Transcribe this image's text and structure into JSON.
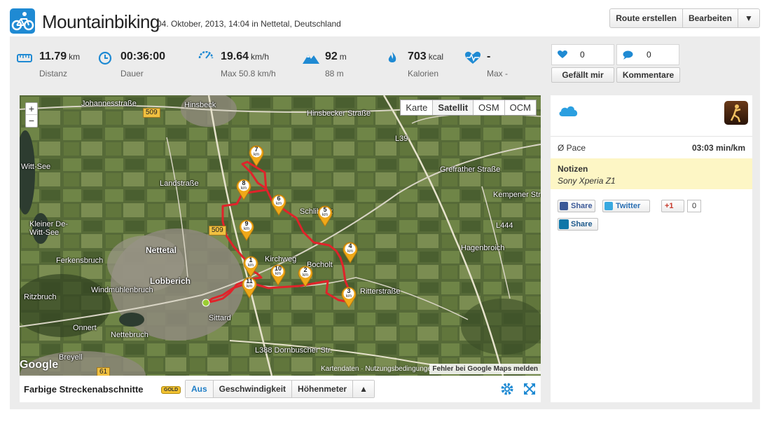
{
  "header": {
    "title": "Mountainbiking",
    "subtitle": "04. Oktober, 2013, 14:04 in Nettetal, Deutschland",
    "buttons": {
      "create_route": "Route erstellen",
      "edit": "Bearbeiten",
      "more": "▼"
    }
  },
  "stats": [
    {
      "icon": "ruler-icon",
      "value": "11.79",
      "unit": "km",
      "label": "Distanz"
    },
    {
      "icon": "clock-icon",
      "value": "00:36:00",
      "unit": "",
      "label": "Dauer"
    },
    {
      "icon": "speedometer-icon",
      "value": "19.64",
      "unit": "km/h",
      "label": "Max 50.8 km/h"
    },
    {
      "icon": "mountain-icon",
      "value": "92",
      "unit": "m",
      "label": "88 m"
    },
    {
      "icon": "flame-icon",
      "value": "703",
      "unit": "kcal",
      "label": "Kalorien"
    },
    {
      "icon": "heartbeat-icon",
      "value": "-",
      "unit": "",
      "label": "Max -"
    }
  ],
  "social": {
    "likes_count": "0",
    "comments_count": "0",
    "like_label": "Gefällt mir",
    "comment_label": "Kommentare"
  },
  "map": {
    "types": [
      "Karte",
      "Satellit",
      "OSM",
      "OCM"
    ],
    "active_type": "Satellit",
    "zoom_in": "+",
    "zoom_out": "−",
    "place_labels": {
      "hinsbeck": "Hinsbeck",
      "johannesstrasse": "Johannesstraße",
      "hinsbecker_strasse": "Hinsbecker Straße",
      "nettetal": "Nettetal",
      "lobberich": "Lobberich",
      "kleiner_de_witt_see": "Kleiner De-Witt-See",
      "ferkensbruch": "Ferkensbruch",
      "windmuehlenbruch": "Windmühlenbruch",
      "ritzbruch": "Ritzbruch",
      "onnert": "Onnert",
      "nettebruch": "Nettebruch",
      "breyell": "Breyell",
      "hagenbroich": "Hagenbroich",
      "sittard": "Sittard",
      "bocholt": "Bocholt",
      "kirchweg": "Kirchweg",
      "schlibeck": "Schlibeck",
      "ritterstrasse": "Ritterstraße",
      "dornbuscher_str": "L388 Dornbuscher Str.",
      "landstrasse": "Landstraße",
      "l39": "L39",
      "l444": "L444",
      "grefrather_strasse": "Grefrather Straße",
      "kempener_strasse": "Kempener Str.",
      "witt_see": "Witt-See"
    },
    "road_numbers": {
      "r509a": "509",
      "r509b": "509",
      "r61": "61"
    },
    "km_markers": [
      "1",
      "2",
      "3",
      "4",
      "5",
      "6",
      "7",
      "8",
      "9",
      "10",
      "11"
    ],
    "km_unit": "km",
    "google": "Google",
    "footer": "Kartendaten · Nutzungsbedingungen",
    "error_link": "Fehler bei Google Maps melden"
  },
  "mapbar": {
    "label": "Farbige Streckenabschnitte",
    "badge": "GOLD",
    "segments": [
      "Aus",
      "Geschwindigkeit",
      "Höhenmeter",
      "▲"
    ],
    "active_segment": "Aus"
  },
  "sidebar": {
    "pace_label": "Ø Pace",
    "pace_value": "03:03 min/km",
    "notes_title": "Notizen",
    "notes_text": "Sony Xperia Z1",
    "share": {
      "facebook": "Share",
      "twitter": "Twitter",
      "gplus": "+1",
      "gplus_count": "0",
      "linkedin": "Share"
    }
  },
  "colors": {
    "accent": "#1f8ad3",
    "route": "#e0232a",
    "marker": "#f0a818",
    "notes_bg": "#fdf6c5",
    "panel_bg": "#ececec"
  }
}
